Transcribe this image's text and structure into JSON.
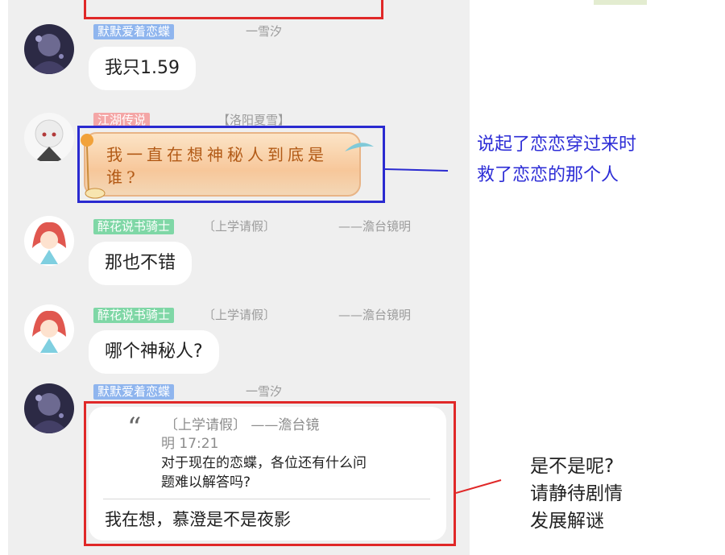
{
  "messages": {
    "m1": {
      "sender": "默默爱着恋蝶",
      "tail": "一雪汐",
      "text": "我只1.59"
    },
    "m2": {
      "sender": "江湖传说",
      "tail": "【洛阳夏雪】",
      "text": "我一直在想神秘人到底是谁?"
    },
    "m3": {
      "sender": "醉花说书骑士",
      "tag": "〔上学请假〕",
      "tail": "——澹台镜明",
      "text": "那也不错"
    },
    "m4": {
      "sender": "醉花说书骑士",
      "tag": "〔上学请假〕",
      "tail": "——澹台镜明",
      "text": "哪个神秘人?"
    },
    "m5": {
      "sender": "默默爱着恋蝶",
      "tail": "一雪汐",
      "quote": {
        "meta_1": "〔上学请假〕            ——澹台镜",
        "meta_2": "明 17:21",
        "text_1": "对于现在的恋蝶，各位还有什么问",
        "text_2": "题难以解答吗?"
      },
      "text": "我在想，慕澄是不是夜影"
    }
  },
  "annotations": {
    "blue_1": "说起了恋恋穿过来时",
    "blue_2": "救了恋恋的那个人",
    "black_1": "是不是呢?",
    "black_2": "请静待剧情",
    "black_3": "发展解谜"
  },
  "colors": {
    "annotation_blue": "#2c2cd6",
    "outline_red": "#e02828",
    "outline_blue": "#2a2ad0",
    "panel_bg": "#efefef"
  }
}
